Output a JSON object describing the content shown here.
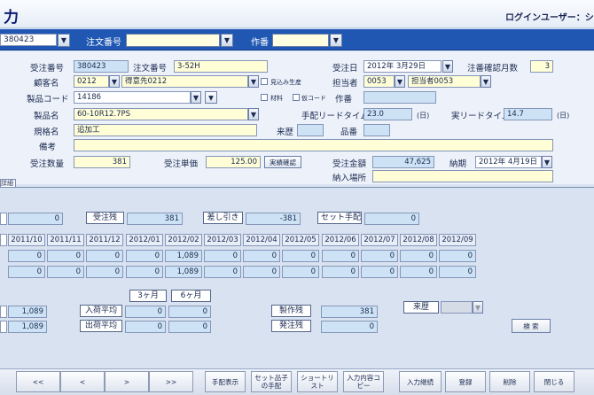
{
  "title": "力",
  "login_label": "ログインユーザー：シス",
  "search": {
    "order_no_value": "380423",
    "chuumon_label": "注文番号",
    "sakuban_label": "作番"
  },
  "form": {
    "juchu_no_label": "受注番号",
    "juchu_no": "380423",
    "chuumon_no_label": "注文番号",
    "chuumon_no": "3-52H",
    "juchubi_label": "受注日",
    "juchubi": "2012年 3月29日",
    "chuban_label": "注番確認月数",
    "chuban_months": "3",
    "kokyaku_label": "顧客名",
    "kokyaku_code": "0212",
    "kokyaku_name": "得意先0212",
    "mikomi_label": "見込み生産",
    "tantou_label": "担当者",
    "tantou_code": "0053",
    "tantou_name": "担当者0053",
    "seihin_code_label": "製品コード",
    "seihin_code": "14186",
    "zairyo_label": "材料",
    "kari_code_label": "仮コード",
    "sakuban_label": "作番",
    "seihin_name_label": "製品名",
    "seihin_name": "60-10R12.7PS",
    "tehai_lt_label": "手配リードタイム",
    "tehai_lt": "23.0",
    "tehai_unit": "(日)",
    "jitsu_lt_label": "実リードタイム",
    "jitsu_lt": "14.7",
    "jitsu_unit": "(日)",
    "kikaku_label": "規格名",
    "kikaku": "追加工",
    "raireki_label": "来歴",
    "hinban_label": "品番",
    "biko_label": "備考",
    "suuryo_label": "受注数量",
    "suuryo": "381",
    "tanka_label": "受注単価",
    "tanka": "125.00",
    "jisseki_btn": "実績確認",
    "kingaku_label": "受注金額",
    "kingaku": "47,625",
    "nouki_label": "納期",
    "nouki": "2012年 4月19日",
    "nounyu_label": "納入場所",
    "tab_label": "詳細"
  },
  "lower": {
    "row1_val1": "0",
    "juchuzan_label": "受注残",
    "juchuzan": "381",
    "sashihiki_label": "差し引き",
    "sashihiki": "-381",
    "set_label": "セット手配",
    "set_val": "0",
    "months": [
      "2011/10",
      "2011/11",
      "2011/12",
      "2012/01",
      "2012/02",
      "2012/03",
      "2012/04",
      "2012/05",
      "2012/06",
      "2012/07",
      "2012/08",
      "2012/09"
    ],
    "row_a": [
      "0",
      "0",
      "0",
      "0",
      "1,089",
      "0",
      "0",
      "0",
      "0",
      "0",
      "0",
      "0"
    ],
    "row_b": [
      "0",
      "0",
      "0",
      "0",
      "1,089",
      "0",
      "0",
      "0",
      "0",
      "0",
      "0",
      "0"
    ],
    "r3_val": "1,089",
    "r4_val": "1,089",
    "three_month": "3ヶ月",
    "six_month": "6ヶ月",
    "nyuka_label": "入荷平均",
    "nyuka_3": "0",
    "nyuka_6": "0",
    "shukka_label": "出荷平均",
    "shukka_3": "0",
    "shukka_6": "0",
    "seisaku_label": "製作残",
    "seisaku": "381",
    "hacchu_label": "発注残",
    "hacchu": "0",
    "raireki_label": "来歴",
    "kensaku_btn": "検 索"
  },
  "buttons": {
    "first": "<<",
    "prev": "<",
    "next": ">",
    "last": ">>",
    "tehai": "手配表示",
    "set_ko": "セット品子の手配",
    "shortlist": "ショートリスト",
    "nyuryoku_copy": "入力内容コピー",
    "keizoku": "入力継続",
    "touroku": "登録",
    "sakujo": "削除",
    "tojiru": "閉じる"
  }
}
